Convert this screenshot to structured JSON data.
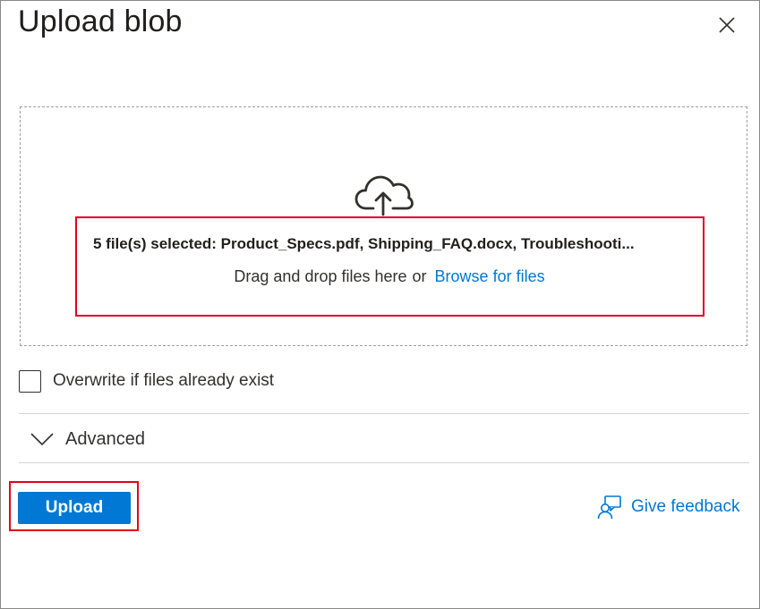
{
  "dialog": {
    "title": "Upload blob"
  },
  "dropzone": {
    "selected_text": "5 file(s) selected: Product_Specs.pdf, Shipping_FAQ.docx, Troubleshooti...",
    "drag_text": "Drag and drop files here",
    "or_text": "or",
    "browse_label": "Browse for files"
  },
  "options": {
    "overwrite_label": "Overwrite if files already exist",
    "overwrite_checked": false,
    "advanced_label": "Advanced"
  },
  "footer": {
    "upload_label": "Upload",
    "feedback_label": "Give feedback"
  },
  "icons": {
    "close": "close-icon",
    "upload": "cloud-upload-icon",
    "advanced": "chevron-down-icon",
    "feedback": "feedback-person-icon"
  },
  "colors": {
    "accent": "#0078d4",
    "highlight": "#e3001b",
    "text": "#323130"
  }
}
